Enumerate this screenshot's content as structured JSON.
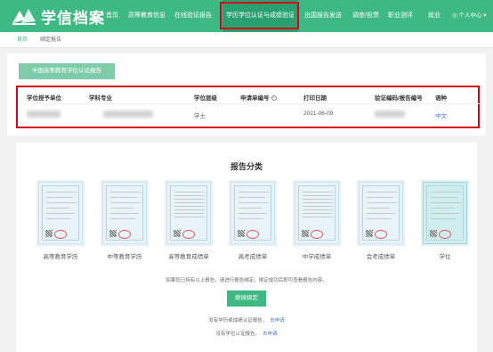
{
  "header": {
    "logo_text": "学信档案",
    "nav": [
      "首页",
      "高等教育信息",
      "在线验证报告",
      "学历学位认证与成绩验证",
      "出国报告发送",
      "调查/投票",
      "职业测评",
      "就业"
    ],
    "user": "◎ 个人中心 ▾"
  },
  "breadcrumb": {
    "home": "首页",
    "current": "绑定报告"
  },
  "report_tab": "中国高等教育学位认证报告",
  "table": {
    "headers": [
      "学位授予单位",
      "学科专业",
      "学位层级",
      "申请单编号",
      "打印日期",
      "验证编码/报告编号",
      "语种"
    ],
    "row": {
      "level": "学士",
      "date": "2021-06-09",
      "language": "中文"
    }
  },
  "section_title": "报告分类",
  "categories": [
    "高等教育学历",
    "中等教育学历",
    "高等教育成绩单",
    "高考成绩单",
    "中学成绩单",
    "会考成绩单",
    "学位"
  ],
  "note": "如果您已持有以上报告，请进行报告绑定，绑定成功后即可查看报告内容。",
  "continue_button": "继续绑定",
  "apply_line1": {
    "text": "没有学历或成绩认证报告，",
    "link": "去申请"
  },
  "apply_line2": {
    "text": "没有学位认证报告，",
    "link": "去申请"
  },
  "colors": {
    "brand": "#3fb984",
    "highlight": "#d9001b",
    "link": "#3a7bd5"
  }
}
